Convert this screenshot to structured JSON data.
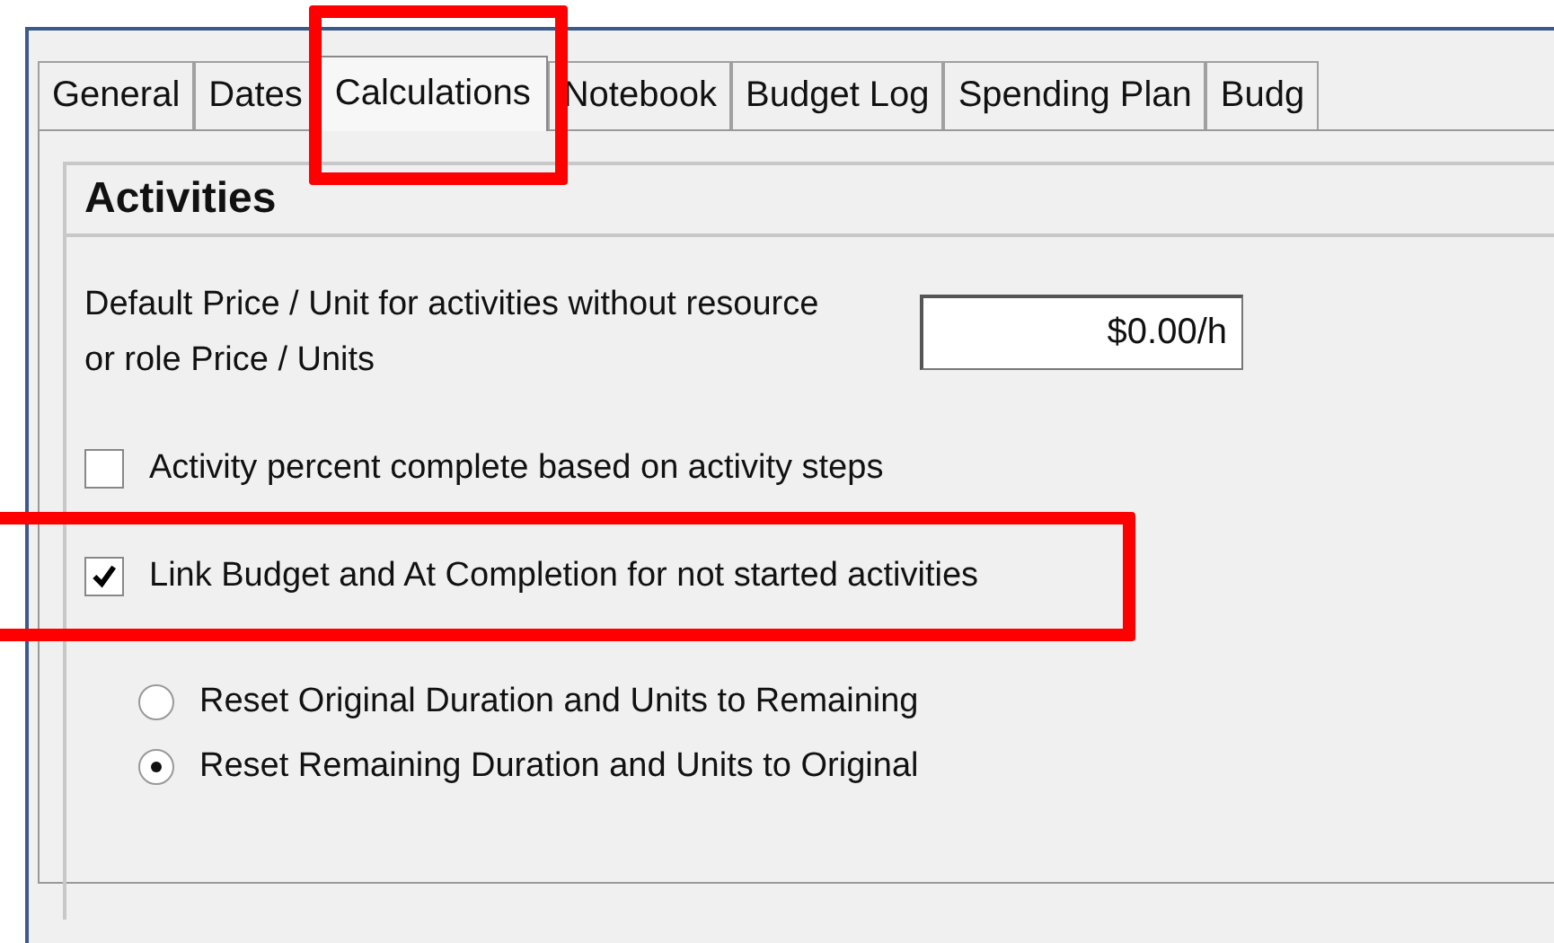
{
  "tabs": [
    {
      "label": "General",
      "selected": false,
      "highlighted": false
    },
    {
      "label": "Dates",
      "selected": false,
      "highlighted": false
    },
    {
      "label": "Calculations",
      "selected": true,
      "highlighted": true
    },
    {
      "label": "Notebook",
      "selected": false,
      "highlighted": false
    },
    {
      "label": "Budget Log",
      "selected": false,
      "highlighted": false
    },
    {
      "label": "Spending Plan",
      "selected": false,
      "highlighted": false
    },
    {
      "label": "Budg",
      "selected": false,
      "highlighted": false
    }
  ],
  "section": {
    "title": "Activities",
    "price_label": "Default Price / Unit for activities without resource or role Price / Units",
    "price_value": "$0.00/h",
    "checkboxes": [
      {
        "label": "Activity percent complete based on activity steps",
        "checked": false,
        "highlighted": false
      },
      {
        "label": "Link Budget and At Completion for not started activities",
        "checked": true,
        "highlighted": true
      }
    ],
    "radios": [
      {
        "label": "Reset Original Duration and Units to Remaining",
        "selected": false
      },
      {
        "label": "Reset Remaining Duration and Units to Original",
        "selected": true
      }
    ]
  }
}
